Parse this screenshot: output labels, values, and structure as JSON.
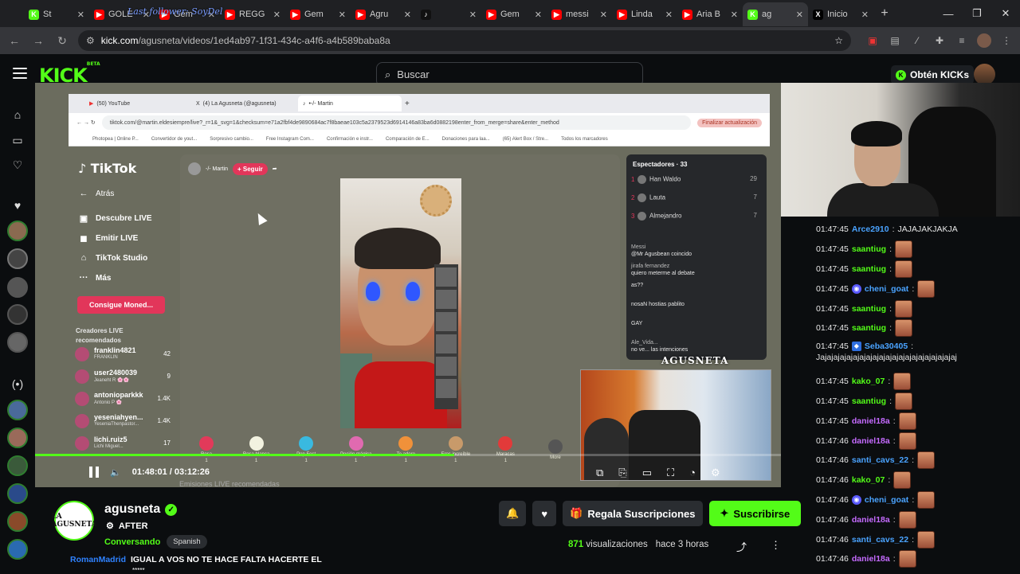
{
  "browser": {
    "tabs": [
      {
        "label": "St",
        "color": "#53fc18",
        "glyph": "K"
      },
      {
        "label": "GOLE",
        "color": "#ff0000",
        "glyph": "▶"
      },
      {
        "label": "Gem",
        "color": "#ff0000",
        "glyph": "▶"
      },
      {
        "label": "REGG",
        "color": "#ff0000",
        "glyph": "▶"
      },
      {
        "label": "Gem",
        "color": "#ff0000",
        "glyph": "▶"
      },
      {
        "label": "Agru",
        "color": "#ff0000",
        "glyph": "▶"
      },
      {
        "label": "",
        "color": "#111111",
        "glyph": "♪"
      },
      {
        "label": "Gem",
        "color": "#ff0000",
        "glyph": "▶"
      },
      {
        "label": "messi",
        "color": "#ff0000",
        "glyph": "▶"
      },
      {
        "label": "Linda",
        "color": "#ff0000",
        "glyph": "▶"
      },
      {
        "label": "Aria B",
        "color": "#ff0000",
        "glyph": "▶"
      },
      {
        "label": "ag",
        "color": "#53fc18",
        "glyph": "K",
        "active": true
      },
      {
        "label": "Inicio",
        "color": "#000000",
        "glyph": "X"
      }
    ],
    "overlay_text": "Last follower: SoyDel",
    "url_host": "kick.com",
    "url_path": "/agusneta/videos/1ed4ab97-1f31-434c-a4f6-a4b589baba8a"
  },
  "kick": {
    "search_placeholder": "Buscar",
    "kicks_label": "Obtén KICKs"
  },
  "inner_browser": {
    "tabs": [
      "(50) YouTube",
      "(4) La Agusneta (@agusneta)",
      "•-/- Martin"
    ],
    "url": "tiktok.com/@martin.eldesiempre/live?_r=1&_svg=1&checksum=e71a2fbf4de9890684ac7f8baeae103c5a2379523d6914146a83ba6d0882198enter_from_merge=share&enter_method",
    "update_label": "Finalizar actualización",
    "bookmarks": [
      "Photopea | Online P...",
      "Convertidor de yout...",
      "Sorpresivo cambio...",
      "Free Instagram Com...",
      "Confirmación e instr...",
      "Comparación de E...",
      "Donaciones para laa...",
      "(65) Alert Box / Stre...",
      "Todos los marcadores"
    ]
  },
  "tiktok": {
    "logo": "TikTok",
    "nav": [
      "Atrás",
      "Descubre LIVE",
      "Emitir LIVE",
      "TikTok Studio",
      "Más"
    ],
    "coins_button": "Consigue Moned...",
    "recommended_heading": "Creadores LIVE recomendados",
    "recommended": [
      {
        "name": "franklin4821",
        "sub": "FRANKLIN",
        "count": "42"
      },
      {
        "name": "user2480039",
        "sub": "Jeaneht R 🌸🌸",
        "count": "9"
      },
      {
        "name": "antonioparkkk",
        "sub": "Antonio P 🌸",
        "count": "1.4K"
      },
      {
        "name": "yeseniahyen...",
        "sub": "YeseniaThenpastor...",
        "count": "1.4K"
      },
      {
        "name": "lichi.ruiz5",
        "sub": "Lichi Miguel...",
        "count": "17"
      }
    ],
    "host_name": "-/- Martin",
    "follow_label": "+ Seguir",
    "viewers_heading": "Espectadores · 33",
    "viewers": [
      {
        "rank": "1",
        "name": "Han Waldo",
        "count": "29"
      },
      {
        "rank": "2",
        "name": "Lauta",
        "count": "7"
      },
      {
        "rank": "3",
        "name": "Almejandro",
        "count": "7"
      }
    ],
    "chat": [
      {
        "user": "Messi",
        "text": "@Mr Agusbean coincido"
      },
      {
        "user": "jirafa fernandez",
        "text": "quiero meterme al debate"
      },
      {
        "user": "",
        "text": "as??"
      },
      {
        "user": "",
        "text": "nosaN hostias pablito"
      },
      {
        "user": "",
        "text": "GAY"
      },
      {
        "user": "Ale_Vida...",
        "text": "no ve... las intenciones"
      }
    ],
    "gifts": [
      {
        "label": "Rosa",
        "color": "#e23a5a"
      },
      {
        "label": "Rosa blanca",
        "color": "#f2f2e0"
      },
      {
        "label": "Pop Fest",
        "color": "#39b9e0"
      },
      {
        "label": "Poción mágica",
        "color": "#e06ab0"
      },
      {
        "label": "Te adoro",
        "color": "#f0913a"
      },
      {
        "label": "Eres increíble",
        "color": "#c89a6a"
      },
      {
        "label": "Maracas",
        "color": "#e23a3a"
      }
    ],
    "gifts_more": "More",
    "below_label": "Emisiones LIVE recomendadas",
    "watermark": "AGUSNETA"
  },
  "player": {
    "current_time": "01:48:01",
    "duration": "03:12:26",
    "progress_fraction": 0.562
  },
  "chat": {
    "messages": [
      {
        "time": "01:47:45",
        "user": "Arce2910",
        "user_color": "#4aa3ff",
        "text": "JAJAJAKJAKJA",
        "emote": false
      },
      {
        "time": "01:47:45",
        "user": "saantiug",
        "user_color": "#53fc18",
        "text": "",
        "emote": true
      },
      {
        "time": "01:47:45",
        "user": "saantiug",
        "user_color": "#53fc18",
        "text": "",
        "emote": true
      },
      {
        "time": "01:47:45",
        "user": "cheni_goat",
        "user_color": "#4aa3ff",
        "text": "",
        "emote": true,
        "badge": "circle"
      },
      {
        "time": "01:47:45",
        "user": "saantiug",
        "user_color": "#53fc18",
        "text": "",
        "emote": true
      },
      {
        "time": "01:47:45",
        "user": "saantiug",
        "user_color": "#53fc18",
        "text": "",
        "emote": true
      },
      {
        "time": "01:47:45",
        "user": "Seba30405",
        "user_color": "#4aa3ff",
        "text": "Jajajajajajajajajajajajajajajajajajajajajaj",
        "emote": false,
        "badge": "square",
        "wrap": true
      },
      {
        "time": "01:47:45",
        "user": "kako_07",
        "user_color": "#53fc18",
        "text": "",
        "emote": true
      },
      {
        "time": "01:47:45",
        "user": "saantiug",
        "user_color": "#53fc18",
        "text": "",
        "emote": true
      },
      {
        "time": "01:47:45",
        "user": "daniel18a",
        "user_color": "#c56bff",
        "text": "",
        "emote": true
      },
      {
        "time": "01:47:46",
        "user": "daniel18a",
        "user_color": "#c56bff",
        "text": "",
        "emote": true
      },
      {
        "time": "01:47:46",
        "user": "santi_cavs_22",
        "user_color": "#4aa3ff",
        "text": "",
        "emote": true
      },
      {
        "time": "01:47:46",
        "user": "kako_07",
        "user_color": "#53fc18",
        "text": "",
        "emote": true
      },
      {
        "time": "01:47:46",
        "user": "cheni_goat",
        "user_color": "#4aa3ff",
        "text": "",
        "emote": true,
        "badge": "circle"
      },
      {
        "time": "01:47:46",
        "user": "daniel18a",
        "user_color": "#c56bff",
        "text": "",
        "emote": true
      },
      {
        "time": "01:47:46",
        "user": "santi_cavs_22",
        "user_color": "#4aa3ff",
        "text": "",
        "emote": true
      },
      {
        "time": "01:47:46",
        "user": "daniel18a",
        "user_color": "#c56bff",
        "text": "",
        "emote": true
      }
    ]
  },
  "channel": {
    "name": "agusneta",
    "avatar_text": "LA AGUSNETA",
    "title": "AFTER",
    "category": "Conversando",
    "tag": "Spanish",
    "gift_subs_label": "Regala Suscripciones",
    "subscribe_label": "Suscribirse",
    "views_count": "871",
    "views_label": "visualizaciones",
    "ago": "hace 3 horas"
  },
  "bottom_chat": {
    "user": "RomanMadrid",
    "text": "IGUAL A VOS NO TE HACE FALTA HACERTE EL",
    "stars": "*****"
  },
  "colors": {
    "accent": "#53fc18",
    "bg": "#0b0d0f"
  }
}
